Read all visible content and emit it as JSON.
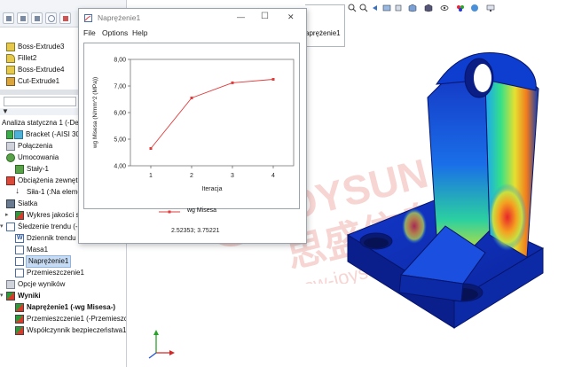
{
  "tree": {
    "features": [
      {
        "label": "Boss-Extrude3",
        "icon": "extrude-icon"
      },
      {
        "label": "Fillet2",
        "icon": "fillet-icon"
      },
      {
        "label": "Boss-Extrude4",
        "icon": "extrude-icon"
      },
      {
        "label": "Cut-Extrude1",
        "icon": "cut-extrude-icon"
      }
    ],
    "study": {
      "title": "Analiza statyczna 1 (-De",
      "bracket": "Bracket (-AISI 30",
      "connections": "Połączenia",
      "fixtures": "Umocowania",
      "fixed": "Stały-1",
      "external_loads": "Obciążenia zewnętr",
      "force": "Siła-1 (:Na elemen",
      "mesh": "Siatka",
      "mesh_quality": "Wykres jakości si",
      "trend_tracker": "Śledzenie trendu (-",
      "trend_journal": "Dziennik trendu",
      "mass": "Masa1",
      "stress": "Naprężenie1",
      "displacement": "Przemieszczenie1",
      "result_options": "Opcje wyników",
      "results": "Wyniki",
      "result_stress": "Naprężenie1 (-wg Misesa-)",
      "result_displacement": "Przemieszczenie1 (-Przemieszcz",
      "result_fos": "Współczynnik bezpieczeństwa1"
    }
  },
  "window": {
    "title": "Naprężenie1",
    "menu": [
      "File",
      "Options",
      "Help"
    ],
    "minimize": "—",
    "maximize": "☐",
    "close": "✕",
    "cursor_readout": "2.52353; 3.75221"
  },
  "background_window": {
    "text": "aprężenie1"
  },
  "chart_data": {
    "type": "line",
    "x": [
      1,
      2,
      3,
      4
    ],
    "series": [
      {
        "name": "wg Misesa",
        "values": [
          4.65,
          6.55,
          7.12,
          7.25
        ],
        "color": "#e23b3b"
      }
    ],
    "xlabel": "Iteracja",
    "ylabel": "wg Misesa (N/mm^2 (MPa))",
    "xticks": [
      "1",
      "2",
      "3",
      "4"
    ],
    "yticks": [
      "4,00",
      "5,00",
      "6,00",
      "7,00",
      "8,00"
    ],
    "xlim": [
      0.5,
      4.5
    ],
    "ylim": [
      4,
      8
    ],
    "grid": false,
    "legend": "bottom"
  },
  "colors": {
    "accent": "#c7dbf3",
    "series": "#e23b3b"
  },
  "watermark": {
    "cn_text": "思盛信息",
    "url": "sw-joysun.com",
    "brand": "JOYSUN"
  }
}
